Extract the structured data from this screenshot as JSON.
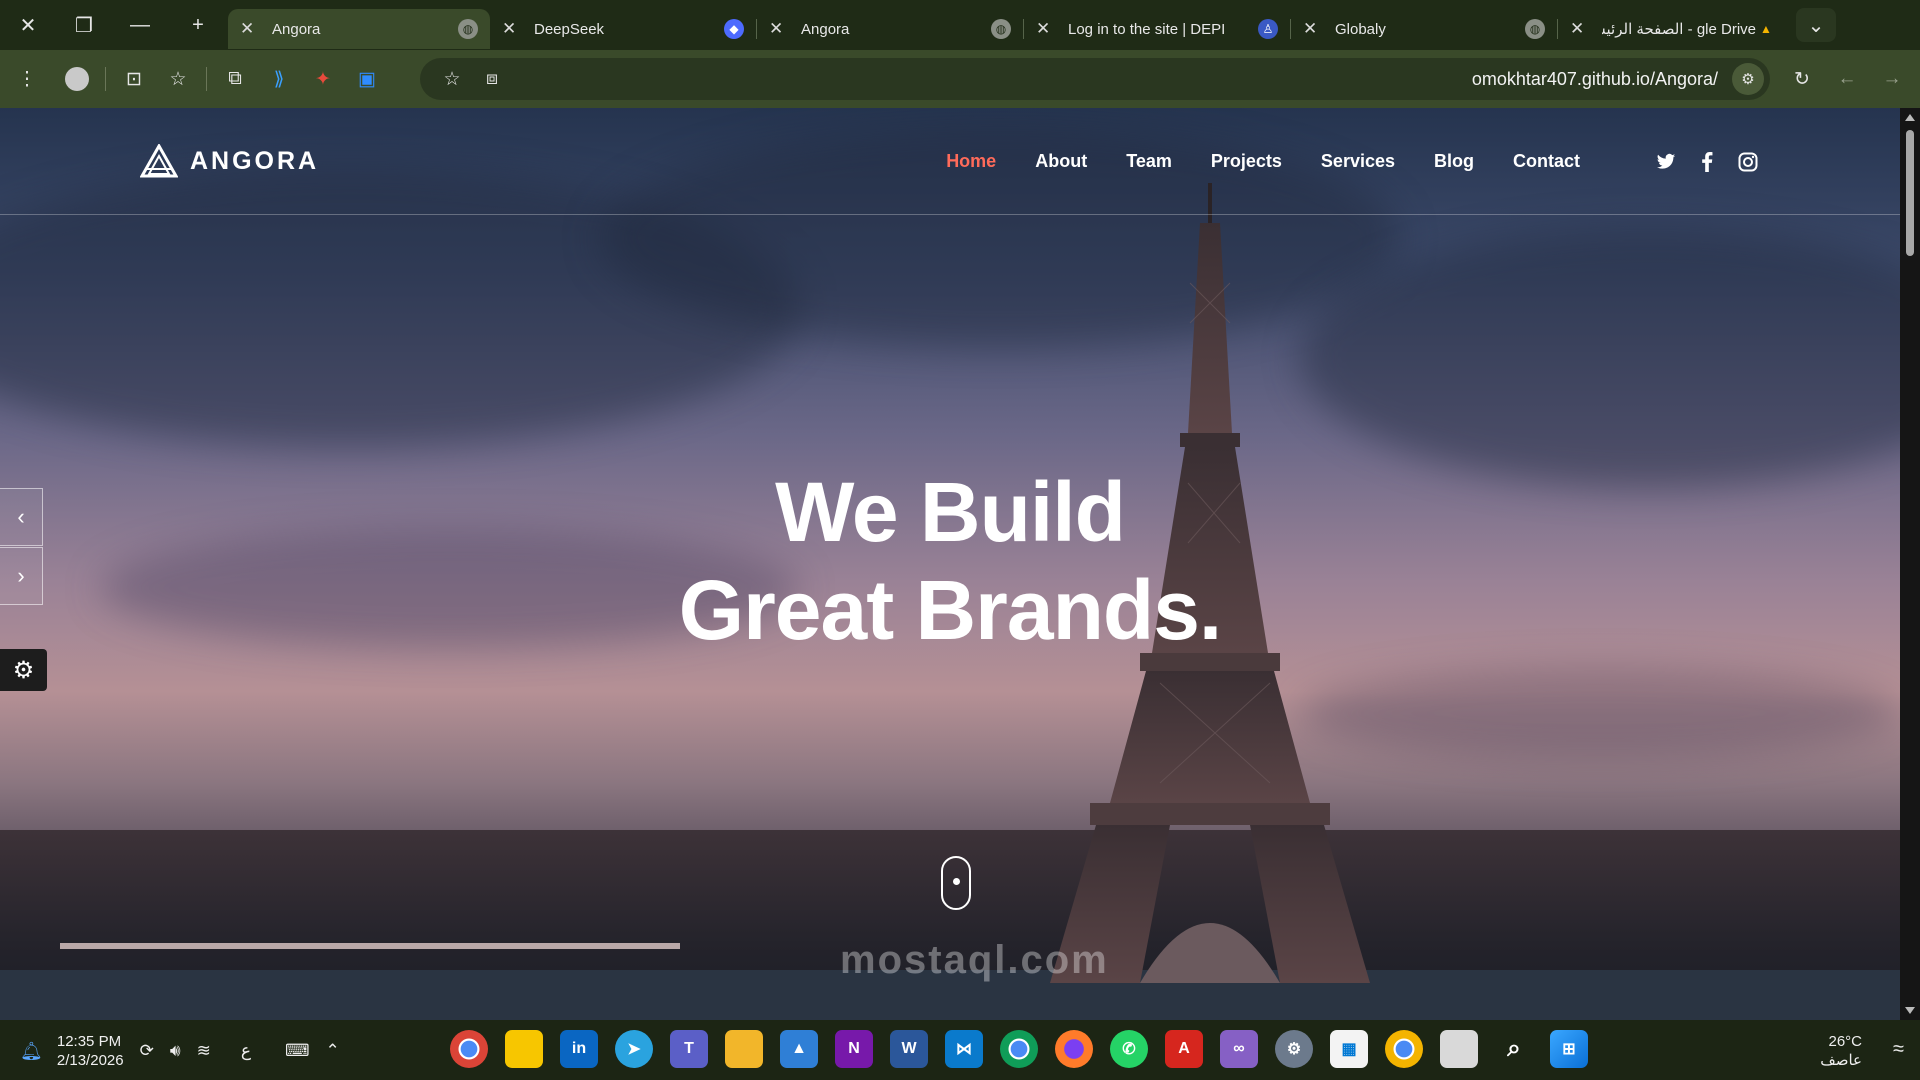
{
  "browser": {
    "tabs": [
      {
        "title": "Angora",
        "active": true,
        "favicon": "globe-icon"
      },
      {
        "title": "DeepSeek",
        "active": false,
        "favicon": "deepseek-icon"
      },
      {
        "title": "Angora",
        "active": false,
        "favicon": "globe-icon"
      },
      {
        "title": "Log in to the site | DEPI",
        "active": false,
        "favicon": "depi-icon"
      },
      {
        "title": "Globaly",
        "active": false,
        "favicon": "globe-icon"
      },
      {
        "title": "gle Drive - الصفحة الرئيسية",
        "active": false,
        "favicon": "drive-icon"
      }
    ],
    "url": "omokhtar407.github.io/Angora/"
  },
  "site": {
    "logo_text": "ANGORA",
    "nav": [
      {
        "label": "Home",
        "active": true
      },
      {
        "label": "About",
        "active": false
      },
      {
        "label": "Team",
        "active": false
      },
      {
        "label": "Projects",
        "active": false
      },
      {
        "label": "Services",
        "active": false
      },
      {
        "label": "Blog",
        "active": false
      },
      {
        "label": "Contact",
        "active": false
      }
    ],
    "social": [
      "twitter-icon",
      "facebook-icon",
      "instagram-icon"
    ],
    "hero": {
      "line1": "We Build",
      "line2": "Great Brands."
    },
    "accent_color": "#ff6b5a",
    "watermark": "mostaql.com"
  },
  "taskbar": {
    "time": "12:35 PM",
    "date": "2/13/2026",
    "keyboard_lang": "ع",
    "temperature": "26°C",
    "weather_text": "عاصف",
    "apps": [
      "chrome",
      "sticky-notes",
      "linkedin",
      "telegram",
      "teams",
      "file-explorer",
      "photos",
      "onenote",
      "word",
      "vscode",
      "chrome",
      "firefox",
      "whatsapp",
      "acrobat",
      "visual-studio",
      "settings",
      "store",
      "chrome-alt",
      "desktop",
      "search",
      "start"
    ]
  }
}
